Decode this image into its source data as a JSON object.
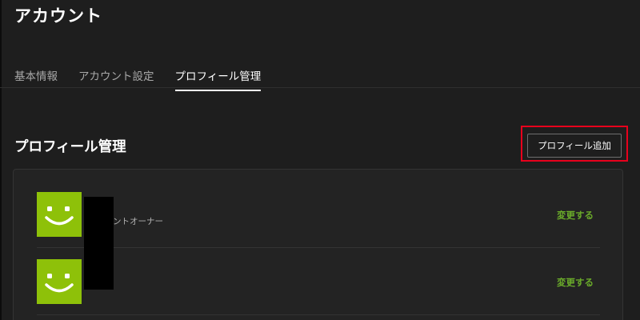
{
  "header": {
    "title": "アカウント"
  },
  "tabs": [
    {
      "label": "基本情報",
      "active": false
    },
    {
      "label": "アカウント設定",
      "active": false
    },
    {
      "label": "プロフィール管理",
      "active": true
    }
  ],
  "section": {
    "title": "プロフィール管理",
    "add_button_label": "プロフィール追加"
  },
  "profiles": [
    {
      "role_label": "ントオーナー",
      "change_label": "変更する",
      "avatar": "smiley-face-icon"
    },
    {
      "role_label": "",
      "change_label": "変更する",
      "avatar": "smiley-face-icon"
    }
  ],
  "colors": {
    "background": "#1e1e1e",
    "avatar_green": "#8ec109",
    "link_green": "#6aaa2a",
    "highlight_red": "#e8001c"
  }
}
